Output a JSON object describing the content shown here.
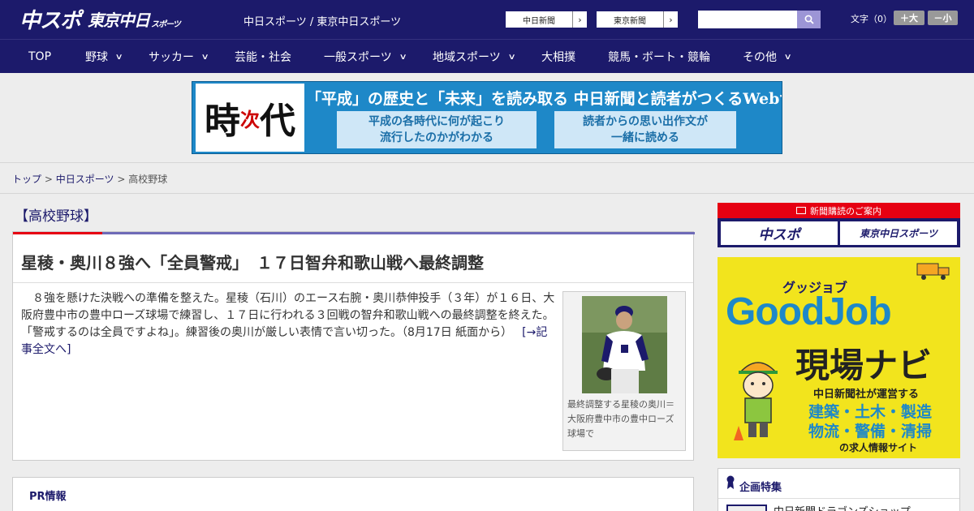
{
  "header": {
    "logo_main": "中スポ",
    "logo_tokyo": "東京中日",
    "logo_tokyo_small": "スポーツ",
    "tagline": "中日スポーツ / 東京中日スポーツ",
    "paper_links": [
      {
        "label": "中日新聞",
        "arrow": "›"
      },
      {
        "label": "東京新聞",
        "arrow": "›"
      }
    ],
    "search": {
      "value": "",
      "placeholder": ""
    },
    "font_size_label": "文字（0）",
    "font_bigger": "＋大",
    "font_smaller": "－小"
  },
  "nav": {
    "items": [
      {
        "label": "TOP",
        "has_dropdown": false
      },
      {
        "label": "野球",
        "has_dropdown": true
      },
      {
        "label": "サッカー",
        "has_dropdown": true
      },
      {
        "label": "芸能・社会",
        "has_dropdown": false
      },
      {
        "label": "一般スポーツ",
        "has_dropdown": true
      },
      {
        "label": "地域スポーツ",
        "has_dropdown": true
      },
      {
        "label": "大相撲",
        "has_dropdown": false
      },
      {
        "label": "競馬・ボート・競輪",
        "has_dropdown": false
      },
      {
        "label": "その他",
        "has_dropdown": true
      }
    ],
    "chevron": "∨"
  },
  "ad_banner": {
    "kanji_top": "時",
    "kanji_red": "次",
    "kanji_bottom": "代",
    "title": "「平成」の歴史と「未来」を読み取る 中日新聞と読者がつくるWebサイト",
    "box_left": [
      "平成の各時代に何が起こり",
      "流行したのかがわかる"
    ],
    "box_right": [
      "読者からの思い出作文が",
      "一緒に読める"
    ]
  },
  "breadcrumb": {
    "items": [
      "トップ",
      "中日スポーツ"
    ],
    "current": "高校野球",
    "separator": ">"
  },
  "main": {
    "section_title": "【高校野球】",
    "article": {
      "headline": "星稜・奥川８強へ「全員警戒」　１７日智弁和歌山戦へ最終調整",
      "body": "　８強を懸けた決戦への準備を整えた。星稜（石川）のエース右腕・奥川恭伸投手（３年）が１６日、大阪府豊中市の豊中ローズ球場で練習し、１７日に行われる３回戦の智弁和歌山戦への最終調整を終えた。　「警戒するのは全員ですよね」。練習後の奥川が厳しい表情で言い切った。（8月17日 紙面から）",
      "read_more": "[→記事全文へ]",
      "photo_caption": "最終調整する星稜の奥川＝大阪府豊中市の豊中ローズ球場で"
    },
    "pr_title": "PR情報"
  },
  "sidebar": {
    "subscription": {
      "heading": "新聞購読のご案内",
      "logo_left": "中スポ",
      "logo_right": "東京中日スポーツ"
    },
    "goodjob_ad": {
      "kana": "グッジョブ",
      "title": "GoodJob",
      "subtitle": "現場ナビ",
      "operator": "中日新聞社が運営する",
      "line1": "建築・土木・製造",
      "line2": "物流・警備・清掃",
      "footer": "の求人情報サイト"
    },
    "special": {
      "title": "企画特集",
      "item": "中日新聞ドラゴンズショップ"
    }
  },
  "colors": {
    "brand_navy": "#1c1a6b",
    "accent_red": "#e60012",
    "accent_purple": "#6e6ab7",
    "ad_blue": "#1e88c8",
    "ad_yellow": "#f2e41d"
  }
}
